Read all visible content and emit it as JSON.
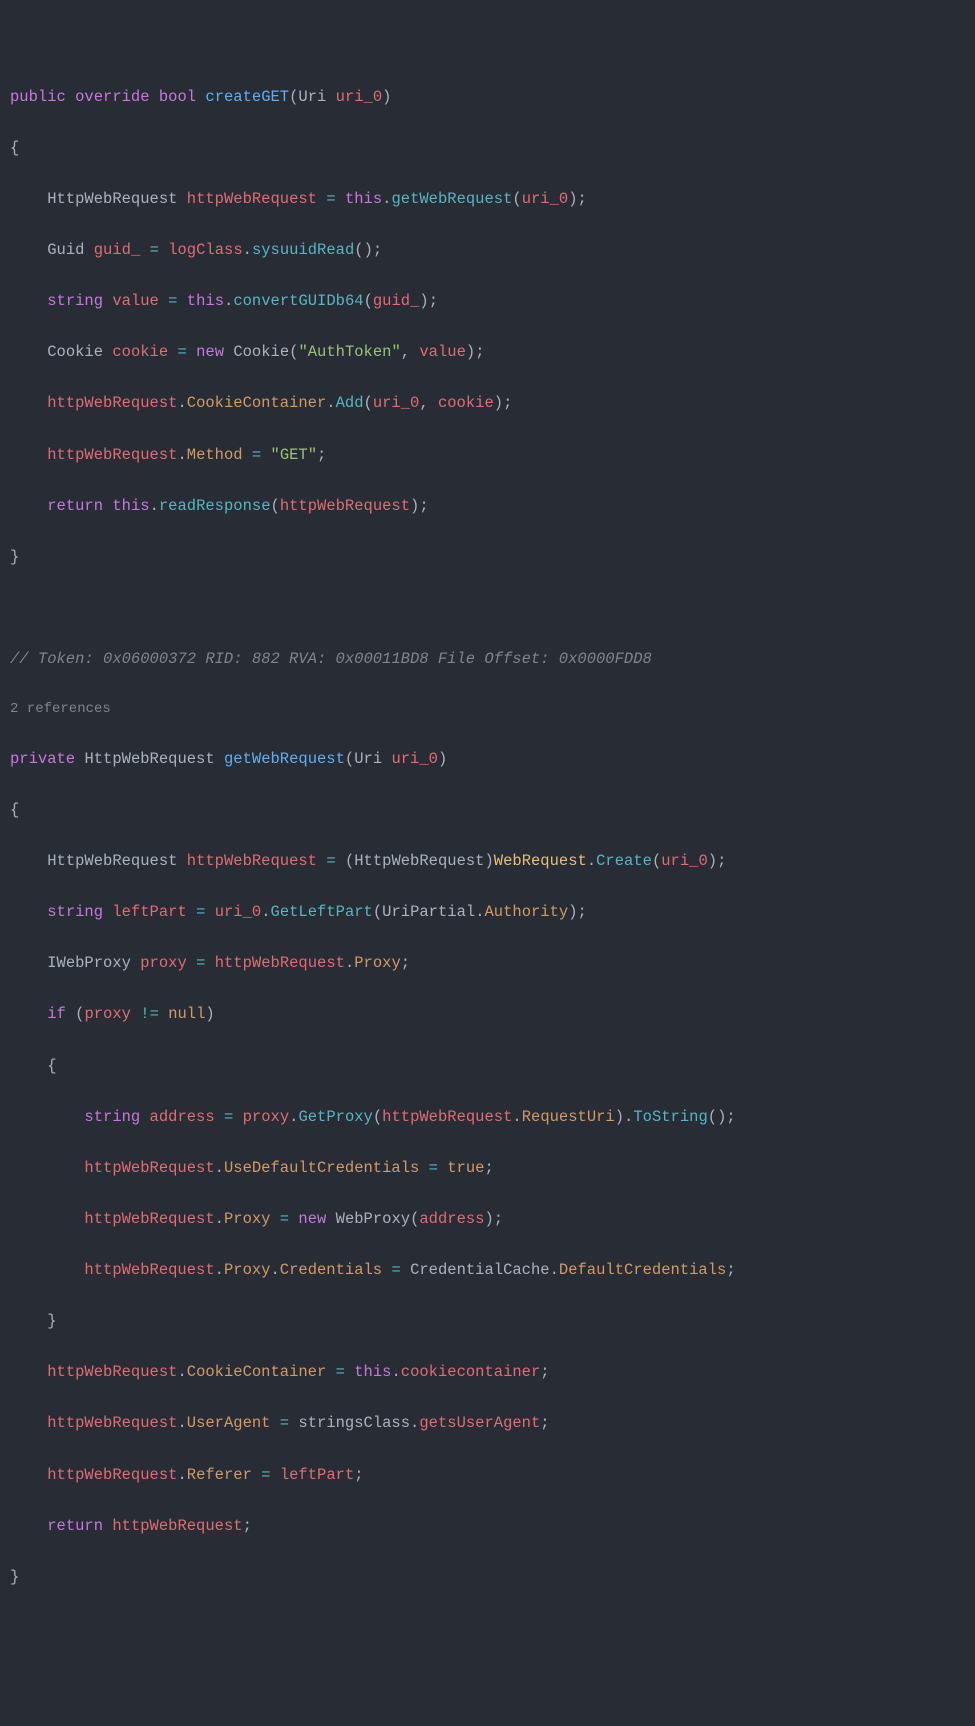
{
  "method1": {
    "signature": {
      "modifiers": [
        "public",
        "override"
      ],
      "returnType": "bool",
      "name": "createGET",
      "paramType": "Uri",
      "paramName": "uri_0"
    },
    "body": {
      "l1_type": "HttpWebRequest",
      "l1_var": "httpWebRequest",
      "l1_this": "this",
      "l1_call": "getWebRequest",
      "l1_arg": "uri_0",
      "l2_type": "Guid",
      "l2_var": "guid_",
      "l2_class": "logClass",
      "l2_call": "sysuuidRead",
      "l3_type": "string",
      "l3_var": "value",
      "l3_this": "this",
      "l3_call": "convertGUIDb64",
      "l3_arg": "guid_",
      "l4_type": "Cookie",
      "l4_var": "cookie",
      "l4_new": "new",
      "l4_class": "Cookie",
      "l4_str1": "\"AuthToken\"",
      "l4_arg2": "value",
      "l5_obj": "httpWebRequest",
      "l5_prop": "CookieContainer",
      "l5_call": "Add",
      "l5_arg1": "uri_0",
      "l5_arg2": "cookie",
      "l6_obj": "httpWebRequest",
      "l6_prop": "Method",
      "l6_val": "\"GET\"",
      "l7_ret": "return",
      "l7_this": "this",
      "l7_call": "readResponse",
      "l7_arg": "httpWebRequest"
    }
  },
  "comment": "// Token: 0x06000372 RID: 882 RVA: 0x00011BD8 File Offset: 0x0000FDD8",
  "references": "2 references",
  "method2": {
    "signature": {
      "modifier": "private",
      "returnType": "HttpWebRequest",
      "name": "getWebRequest",
      "paramType": "Uri",
      "paramName": "uri_0"
    },
    "body": {
      "l1_type": "HttpWebRequest",
      "l1_var": "httpWebRequest",
      "l1_cast": "HttpWebRequest",
      "l1_class": "WebRequest",
      "l1_call": "Create",
      "l1_arg": "uri_0",
      "l2_type": "string",
      "l2_var": "leftPart",
      "l2_obj": "uri_0",
      "l2_call": "GetLeftPart",
      "l2_enum": "UriPartial",
      "l2_enumval": "Authority",
      "l3_type": "IWebProxy",
      "l3_var": "proxy",
      "l3_obj": "httpWebRequest",
      "l3_prop": "Proxy",
      "l4_if": "if",
      "l4_var": "proxy",
      "l4_op": "!=",
      "l4_null": "null",
      "l5_type": "string",
      "l5_var": "address",
      "l5_obj": "proxy",
      "l5_call": "GetProxy",
      "l5_arg_obj": "httpWebRequest",
      "l5_arg_prop": "RequestUri",
      "l5_call2": "ToString",
      "l6_obj": "httpWebRequest",
      "l6_prop": "UseDefaultCredentials",
      "l6_val": "true",
      "l7_obj": "httpWebRequest",
      "l7_prop": "Proxy",
      "l7_new": "new",
      "l7_class": "WebProxy",
      "l7_arg": "address",
      "l8_obj": "httpWebRequest",
      "l8_prop1": "Proxy",
      "l8_prop2": "Credentials",
      "l8_class": "CredentialCache",
      "l8_prop3": "DefaultCredentials",
      "l9_obj": "httpWebRequest",
      "l9_prop": "CookieContainer",
      "l9_this": "this",
      "l9_prop2": "cookiecontainer",
      "l10_obj": "httpWebRequest",
      "l10_prop": "UserAgent",
      "l10_class": "stringsClass",
      "l10_prop2": "getsUserAgent",
      "l11_obj": "httpWebRequest",
      "l11_prop": "Referer",
      "l11_val": "leftPart",
      "l12_ret": "return",
      "l12_val": "httpWebRequest"
    }
  }
}
